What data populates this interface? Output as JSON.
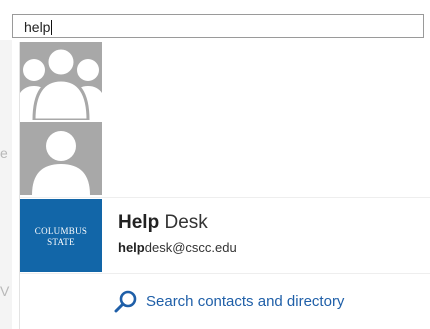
{
  "search": {
    "value": "help"
  },
  "results": [
    {
      "type": "group",
      "avatar_icon": "group-avatar-icon"
    },
    {
      "type": "person",
      "avatar_icon": "person-avatar-icon"
    },
    {
      "type": "contact",
      "name_match": "Help",
      "name_rest": " Desk",
      "email_match": "help",
      "email_rest": "desk@cscc.edu",
      "logo_line1": "COLUMBUS",
      "logo_line2": "STATE",
      "logo_color": "#1266a8"
    }
  ],
  "footer": {
    "search_link_label": "Search contacts and directory",
    "search_link_icon": "search-icon",
    "link_color": "#1f5fa8"
  },
  "background": {
    "letters": [
      "e",
      "V"
    ]
  }
}
